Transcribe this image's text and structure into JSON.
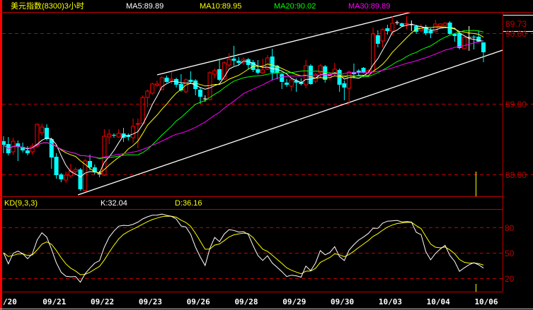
{
  "header": {
    "title": "美元指数(8300)3小时",
    "ma5": "MA5:89.89",
    "ma10": "MA10:89.95",
    "ma20": "MA20:90.02",
    "ma30": "MA30:89.89",
    "current_price": "89.73"
  },
  "kd_header": {
    "title": "KD(9,3,3)",
    "k": "K:32.04",
    "d": "D:36.16"
  },
  "colors": {
    "up": "#ff0000",
    "down": "#00ffff",
    "doji": "#ffffff",
    "ma5": "#ffffff",
    "ma10": "#ffff00",
    "ma20": "#00ff00",
    "ma30": "#ff00ff",
    "k_line": "#ffffff",
    "d_line": "#ffff00",
    "grid": "#c00000",
    "border": "#ff0000",
    "background": "#000000"
  },
  "chart_data": [
    {
      "type": "candlestick",
      "title": "美元指数(8300)3小时",
      "y_ticks": [
        "90.00",
        "89.00",
        "88.00"
      ],
      "ylim": [
        87.7,
        90.3
      ],
      "grid": "dashed horizontal at 90.00, 89.00, 88.00",
      "moving_averages": [
        5,
        10,
        20,
        30
      ],
      "x_tick_labels": [
        {
          "label": "/20",
          "bar": 0
        },
        {
          "label": "09/21",
          "bar": 10
        },
        {
          "label": "09/22",
          "bar": 20
        },
        {
          "label": "09/23",
          "bar": 30
        },
        {
          "label": "09/26",
          "bar": 40
        },
        {
          "label": "09/28",
          "bar": 50
        },
        {
          "label": "09/29",
          "bar": 60
        },
        {
          "label": "09/30",
          "bar": 70
        },
        {
          "label": "10/03",
          "bar": 80
        },
        {
          "label": "10/04",
          "bar": 90
        },
        {
          "label": "10/06",
          "bar": 100
        }
      ],
      "trendlines": [
        {
          "from_bar": 32,
          "from_price": 89.41,
          "to_bar": 100,
          "to_price": 90.55
        },
        {
          "from_bar": 15.5,
          "from_price": 87.71,
          "to_bar": 104,
          "to_price": 89.76
        }
      ],
      "cursor_bar": 98,
      "candles_ohlc": [
        [
          88.47,
          88.54,
          88.3,
          88.42
        ],
        [
          88.43,
          88.53,
          88.27,
          88.3
        ],
        [
          88.32,
          88.52,
          88.28,
          88.47
        ],
        [
          88.44,
          88.48,
          88.19,
          88.39
        ],
        [
          88.39,
          88.45,
          88.31,
          88.34
        ],
        [
          88.34,
          88.4,
          88.27,
          88.3
        ],
        [
          88.32,
          88.44,
          88.28,
          88.4
        ],
        [
          88.4,
          88.72,
          88.38,
          88.71
        ],
        [
          88.59,
          88.72,
          88.55,
          88.67
        ],
        [
          88.66,
          88.71,
          88.48,
          88.5
        ],
        [
          88.5,
          88.52,
          88.08,
          88.24
        ],
        [
          88.25,
          88.3,
          87.94,
          87.99
        ],
        [
          88.0,
          88.02,
          87.89,
          87.93
        ],
        [
          87.92,
          88.04,
          87.88,
          87.99
        ],
        [
          87.98,
          88.15,
          87.95,
          88.05
        ],
        [
          88.04,
          88.1,
          88.02,
          88.07
        ],
        [
          88.07,
          88.09,
          87.77,
          87.79
        ],
        [
          87.77,
          88.22,
          87.76,
          88.19
        ],
        [
          88.19,
          88.28,
          88.06,
          88.1
        ],
        [
          88.1,
          88.14,
          88.0,
          88.03
        ],
        [
          88.02,
          88.05,
          87.96,
          88.0
        ],
        [
          87.99,
          88.64,
          87.98,
          88.54
        ],
        [
          88.53,
          88.64,
          88.43,
          88.57
        ],
        [
          88.56,
          88.58,
          88.52,
          88.55
        ],
        [
          88.53,
          88.64,
          88.52,
          88.58
        ],
        [
          88.58,
          88.66,
          88.46,
          88.52
        ],
        [
          88.55,
          88.58,
          88.48,
          88.53
        ],
        [
          88.52,
          88.79,
          88.45,
          88.68
        ],
        [
          88.71,
          88.79,
          88.37,
          88.72
        ],
        [
          88.72,
          89.12,
          88.7,
          89.09
        ],
        [
          89.09,
          89.2,
          88.95,
          89.18
        ],
        [
          89.15,
          89.3,
          89.13,
          89.28
        ],
        [
          89.26,
          89.33,
          89.24,
          89.28
        ],
        [
          89.2,
          89.39,
          89.2,
          89.37
        ],
        [
          89.37,
          89.4,
          89.3,
          89.31
        ],
        [
          89.33,
          89.45,
          89.28,
          89.35
        ],
        [
          89.35,
          89.37,
          89.23,
          89.27
        ],
        [
          89.28,
          89.42,
          89.17,
          89.19
        ],
        [
          89.17,
          89.36,
          89.15,
          89.34
        ],
        [
          89.34,
          89.46,
          89.28,
          89.31
        ],
        [
          89.33,
          89.35,
          89.12,
          89.21
        ],
        [
          89.2,
          89.23,
          89.0,
          89.1
        ],
        [
          89.07,
          89.12,
          89.03,
          89.07
        ],
        [
          89.06,
          89.46,
          89.05,
          89.44
        ],
        [
          89.42,
          89.5,
          89.36,
          89.47
        ],
        [
          89.49,
          89.64,
          89.32,
          89.34
        ],
        [
          89.35,
          89.6,
          89.34,
          89.58
        ],
        [
          89.55,
          89.72,
          89.52,
          89.63
        ],
        [
          89.64,
          89.82,
          89.54,
          89.61
        ],
        [
          89.61,
          89.66,
          89.55,
          89.58
        ],
        [
          89.58,
          89.66,
          89.55,
          89.63
        ],
        [
          89.63,
          89.65,
          89.49,
          89.55
        ],
        [
          89.59,
          89.62,
          89.45,
          89.48
        ],
        [
          89.49,
          89.62,
          89.42,
          89.44
        ],
        [
          89.44,
          89.64,
          89.42,
          89.48
        ],
        [
          89.49,
          89.69,
          89.48,
          89.65
        ],
        [
          89.67,
          89.78,
          89.34,
          89.44
        ],
        [
          89.54,
          89.55,
          89.35,
          89.44
        ],
        [
          89.42,
          89.43,
          89.21,
          89.31
        ],
        [
          89.3,
          89.35,
          89.24,
          89.27
        ],
        [
          89.25,
          89.36,
          89.18,
          89.34
        ],
        [
          89.33,
          89.36,
          89.17,
          89.3
        ],
        [
          89.31,
          89.36,
          89.26,
          89.28
        ],
        [
          89.27,
          89.62,
          89.22,
          89.54
        ],
        [
          89.54,
          89.56,
          89.27,
          89.28
        ],
        [
          89.32,
          89.44,
          89.29,
          89.42
        ],
        [
          89.44,
          89.56,
          89.37,
          89.54
        ],
        [
          89.53,
          89.55,
          89.3,
          89.34
        ],
        [
          89.37,
          89.45,
          89.33,
          89.42
        ],
        [
          89.44,
          89.58,
          89.4,
          89.49
        ],
        [
          89.48,
          89.5,
          89.17,
          89.27
        ],
        [
          89.29,
          89.33,
          89.05,
          89.23
        ],
        [
          89.22,
          89.47,
          89.0,
          89.45
        ],
        [
          89.45,
          89.57,
          89.36,
          89.42
        ],
        [
          89.47,
          89.49,
          89.4,
          89.44
        ],
        [
          89.51,
          89.52,
          89.43,
          89.44
        ],
        [
          89.44,
          89.49,
          89.42,
          89.47
        ],
        [
          89.45,
          90.08,
          89.44,
          89.99
        ],
        [
          89.97,
          90.04,
          89.8,
          89.85
        ],
        [
          89.89,
          90.07,
          89.8,
          90.05
        ],
        [
          90.07,
          90.12,
          89.98,
          90.03
        ],
        [
          90.03,
          90.24,
          89.97,
          90.14
        ],
        [
          90.15,
          90.18,
          90.12,
          90.15
        ],
        [
          90.14,
          90.15,
          90.09,
          90.1
        ],
        [
          90.13,
          90.24,
          90.06,
          90.14
        ],
        [
          90.12,
          90.18,
          90.03,
          90.12
        ],
        [
          90.1,
          90.12,
          89.99,
          90.02
        ],
        [
          90.04,
          90.13,
          90.02,
          90.09
        ],
        [
          90.09,
          90.12,
          89.97,
          90.0
        ],
        [
          90.04,
          90.07,
          89.93,
          90.0
        ],
        [
          90.02,
          90.19,
          90.02,
          90.13
        ],
        [
          90.1,
          90.14,
          90.08,
          90.13
        ],
        [
          90.11,
          90.16,
          90.11,
          90.14
        ],
        [
          90.15,
          90.17,
          89.98,
          89.99
        ],
        [
          89.99,
          90.0,
          89.88,
          89.96
        ],
        [
          90.0,
          90.01,
          89.77,
          89.79
        ],
        [
          89.78,
          89.95,
          89.77,
          89.94
        ],
        [
          89.94,
          90.1,
          89.75,
          89.94
        ],
        [
          89.95,
          89.97,
          89.77,
          89.94
        ],
        [
          89.95,
          90.03,
          89.88,
          89.88
        ],
        [
          89.87,
          89.87,
          89.59,
          89.73
        ]
      ]
    },
    {
      "type": "line",
      "title": "KD(9,3,3)",
      "series_labels": [
        "K:32.04",
        "D:36.16"
      ],
      "y_ticks": [
        "80",
        "50",
        "20"
      ],
      "ylim": [
        0,
        100
      ],
      "grid": "dashed horizontal at 80, 50, 20"
    }
  ]
}
